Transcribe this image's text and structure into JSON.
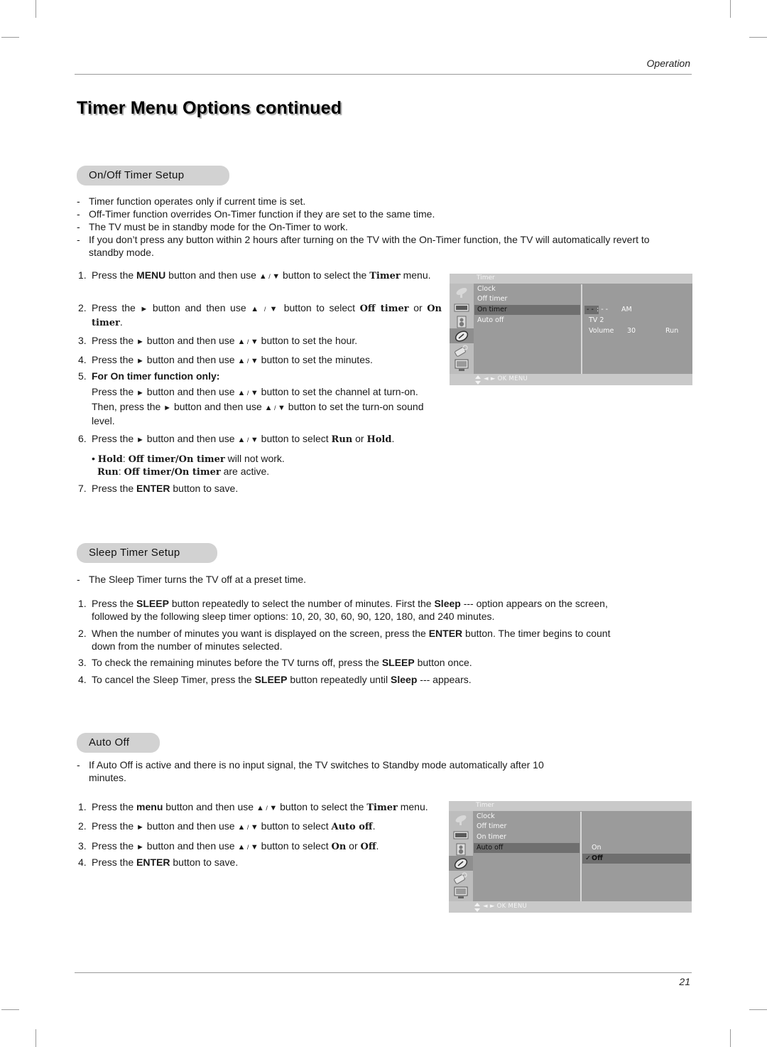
{
  "header": {
    "section_label": "Operation"
  },
  "page_title": "Timer Menu Options continued",
  "sections": {
    "on_off_timer": {
      "heading": "On/Off Timer Setup",
      "notes": [
        "Timer function operates only if current time is set.",
        "Off-Timer function overrides On-Timer function if they are set to the same time.",
        "The TV must be in standby mode for the On-Timer to work.",
        "If you don’t press any button within 2 hours after turning on the TV with the On-Timer function, the TV will automatically revert to standby mode."
      ],
      "steps": [
        {
          "num": "1.",
          "parts": [
            "Press the ",
            "MENU",
            " button and then use ",
            "▲",
            " / ",
            "▼",
            "  button to select the ",
            "Timer",
            " menu."
          ]
        },
        {
          "num": "2.",
          "parts": [
            "Press the ",
            "►",
            "  button and then use ",
            "▲",
            " / ",
            "▼",
            " button to select ",
            "Off timer",
            " or ",
            "On timer",
            "."
          ]
        },
        {
          "num": "3.",
          "parts": [
            "Press the ",
            "►",
            "  button and then use ",
            "▲",
            " / ",
            "▼",
            " button to set the hour."
          ]
        },
        {
          "num": "4.",
          "parts": [
            "Press the ",
            "►",
            "  button and then use ",
            "▲",
            " / ",
            "▼",
            " button to set the minutes."
          ]
        },
        {
          "num": "5.",
          "heading": "For On timer function only:",
          "line1": [
            "Press the ",
            "►",
            "  button and then use ",
            "▲",
            " / ",
            "▼",
            " button to set the channel at turn-on."
          ],
          "line2": [
            "Then, press the ",
            "►",
            "  button and then use ",
            "▲",
            " / ",
            "▼",
            " button to set the turn-on sound level."
          ]
        },
        {
          "num": "6.",
          "parts": [
            "Press the ",
            "►",
            "  button and then use ",
            "▲",
            " / ",
            "▼",
            " button to select ",
            "Run",
            " or ",
            "Hold",
            "."
          ]
        },
        {
          "num": "7.",
          "parts": [
            "Press the ",
            "ENTER",
            " button to save."
          ]
        }
      ],
      "bullet": {
        "hold_label": "Hold",
        "hold_sep": ": ",
        "hold_target": "Off timer/On timer",
        "hold_text": " will not work.",
        "run_label": "Run",
        "run_sep": ": ",
        "run_target": "Off timer/On timer",
        "run_text": " are active."
      },
      "osd": {
        "title": "Timer",
        "items": [
          "Clock",
          "Off timer",
          "On timer",
          "Auto off"
        ],
        "selected_index": 2,
        "values": {
          "time_hour": "- -",
          "time_sep": ": - -",
          "ampm": "AM",
          "channel": "TV 2",
          "volume_label": "Volume",
          "volume_value": "30",
          "mode": "Run"
        },
        "footer_hint": "◄ ► OK   MENU",
        "icons": [
          "satellite-dish-icon",
          "picture-icon",
          "speaker-icon",
          "timer-icon",
          "special-icon",
          "pc-screen-icon"
        ],
        "selected_icon_index": 3
      }
    },
    "sleep_timer": {
      "heading": "Sleep Timer Setup",
      "note": "The Sleep Timer turns the TV off at a preset time.",
      "steps": [
        {
          "num": "1.",
          "parts": [
            "Press the ",
            "SLEEP",
            " button repeatedly to select the number of minutes. First the  ",
            "Sleep",
            " ---  option appears on the screen, followed by the following sleep timer options: 10, 20, 30, 60, 90, 120, 180, and 240 minutes."
          ]
        },
        {
          "num": "2.",
          "parts": [
            "When the number of minutes you want is displayed on the screen, press the ",
            "ENTER",
            " button. The timer begins to count down from the number of minutes selected."
          ]
        },
        {
          "num": "3.",
          "parts": [
            "To check the remaining minutes before the TV turns off, press the ",
            "SLEEP",
            " button once."
          ]
        },
        {
          "num": "4.",
          "parts": [
            "To cancel the Sleep Timer, press the ",
            "SLEEP",
            " button repeatedly until ",
            "Sleep",
            " --- appears."
          ]
        }
      ]
    },
    "auto_off": {
      "heading": "Auto Off",
      "note": "If Auto Off is active and there is no input signal, the TV switches to Standby mode automatically after 10 minutes.",
      "steps": [
        {
          "num": "1.",
          "parts": [
            "Press the ",
            "menu",
            " button and then use ",
            "▲",
            " / ",
            "▼",
            " button to select the ",
            "Timer",
            " menu."
          ]
        },
        {
          "num": "2.",
          "parts": [
            "Press the ",
            "►",
            "  button and then use ",
            "▲",
            " / ",
            "▼",
            " button to select ",
            "Auto off",
            "."
          ]
        },
        {
          "num": "3.",
          "parts": [
            "Press the ",
            "►",
            "  button and then use ",
            "▲",
            " / ",
            "▼",
            " button to select ",
            "On",
            " or ",
            "Off",
            "."
          ]
        },
        {
          "num": "4.",
          "parts": [
            "Press the ",
            "ENTER",
            " button to save."
          ]
        }
      ],
      "osd": {
        "title": "Timer",
        "items": [
          "Clock",
          "Off timer",
          "On timer",
          "Auto off"
        ],
        "selected_index": 3,
        "options": [
          "On",
          "Off"
        ],
        "selected_option": "Off",
        "check_mark": "✓",
        "footer_hint": "◄ ► OK   MENU",
        "icons": [
          "satellite-dish-icon",
          "picture-icon",
          "speaker-icon",
          "timer-icon",
          "special-icon",
          "pc-screen-icon"
        ],
        "selected_icon_index": 3
      }
    }
  },
  "footer": {
    "page_number": "21"
  }
}
